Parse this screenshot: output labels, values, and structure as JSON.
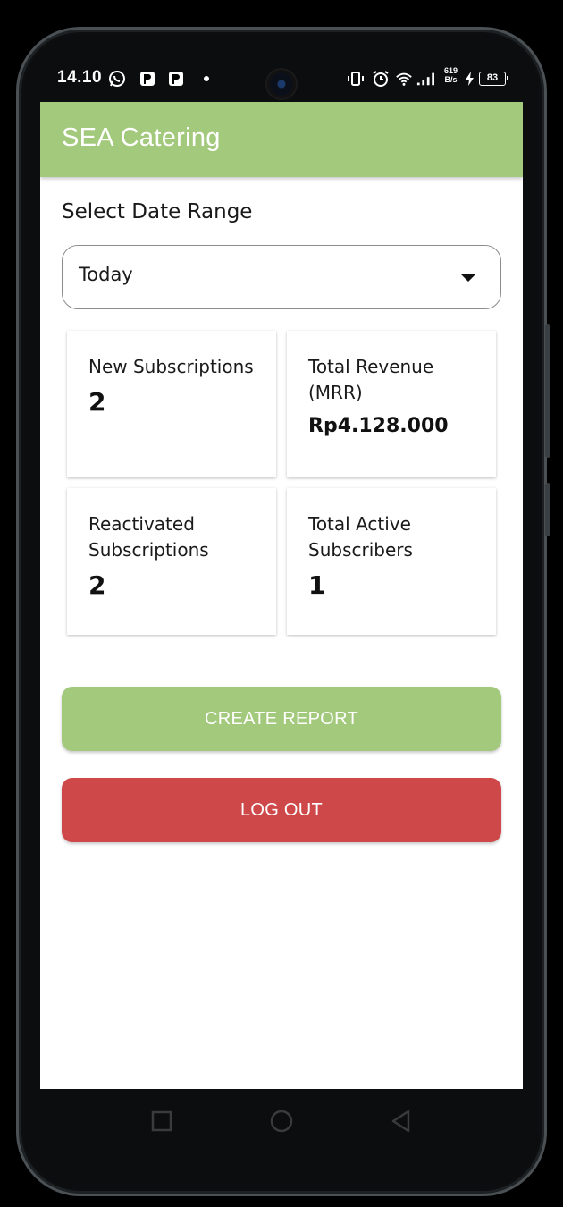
{
  "status_bar": {
    "time": "14.10",
    "net_speed_value": "619",
    "net_speed_unit": "B/s",
    "battery": "83"
  },
  "app": {
    "title": "SEA Catering"
  },
  "date_range": {
    "label": "Select Date Range",
    "selected": "Today"
  },
  "stats": {
    "new_subscriptions": {
      "label": "New Subscriptions",
      "value": "2"
    },
    "total_revenue": {
      "label": "Total Revenue (MRR)",
      "value": "Rp4.128.000"
    },
    "reactivated_subscriptions": {
      "label": "Reactivated Subscriptions",
      "value": "2"
    },
    "total_active_subscribers": {
      "label": "Total Active Subscribers",
      "value": "1"
    }
  },
  "actions": {
    "create_report": "CREATE REPORT",
    "log_out": "LOG OUT"
  },
  "colors": {
    "primary": "#a3c97d",
    "danger": "#ce4849"
  }
}
